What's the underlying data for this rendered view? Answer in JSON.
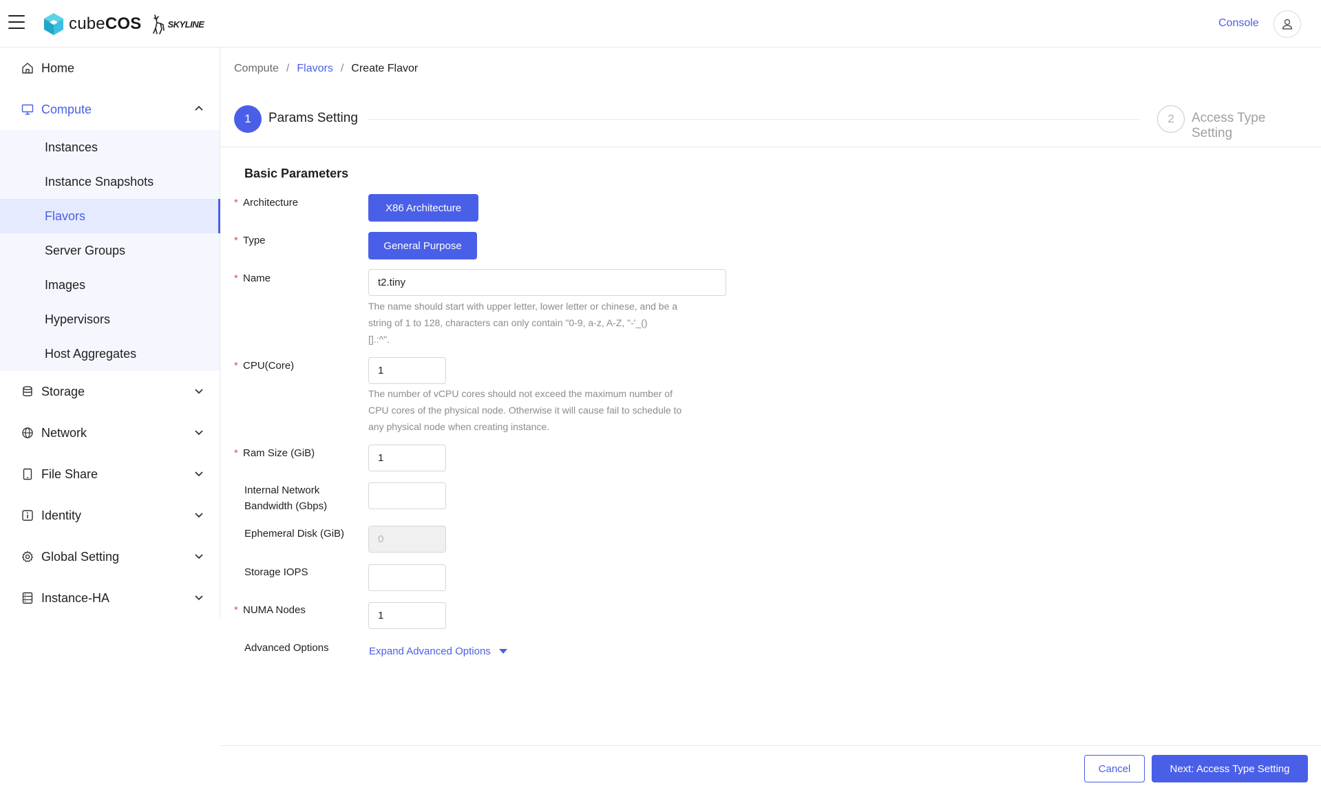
{
  "header": {
    "brand_prefix": "cube",
    "brand_suffix": "COS",
    "skyline_label": "SKYLINE",
    "console_label": "Console",
    "icons": {
      "menu": "hamburger-menu-icon",
      "logo": "cube-logo-icon",
      "skyline": "skyline-deer-icon",
      "user": "user-icon"
    }
  },
  "sidebar": {
    "items": [
      {
        "label": "Home",
        "icon": "home-icon"
      },
      {
        "label": "Compute",
        "icon": "monitor-icon",
        "expanded": true,
        "children": [
          "Instances",
          "Instance Snapshots",
          "Flavors",
          "Server Groups",
          "Images",
          "Hypervisors",
          "Host Aggregates"
        ],
        "selected_child": "Flavors"
      },
      {
        "label": "Storage",
        "icon": "database-icon"
      },
      {
        "label": "Network",
        "icon": "globe-icon"
      },
      {
        "label": "File Share",
        "icon": "tablet-icon"
      },
      {
        "label": "Identity",
        "icon": "info-icon"
      },
      {
        "label": "Global Setting",
        "icon": "gear-icon"
      },
      {
        "label": "Instance-HA",
        "icon": "server-icon"
      }
    ]
  },
  "breadcrumb": {
    "items": [
      "Compute",
      "Flavors",
      "Create Flavor"
    ],
    "separator": "/"
  },
  "steps": [
    {
      "number": "1",
      "label": "Params Setting",
      "status": "active"
    },
    {
      "number": "2",
      "label": "Access Type Setting",
      "status": "pending"
    }
  ],
  "form": {
    "section_title": "Basic Parameters",
    "architecture": {
      "label": "Architecture",
      "value": "X86 Architecture"
    },
    "type": {
      "label": "Type",
      "value": "General Purpose"
    },
    "name": {
      "label": "Name",
      "value": "t2.tiny",
      "help_line1": "The name should start with upper letter, lower letter or chinese, and be a",
      "help_line2": "string of 1 to 128, characters can only contain \"0-9, a-z, A-Z, \"-'_()",
      "help_line3": "[].:^\"."
    },
    "cpu": {
      "label": "CPU(Core)",
      "value": "1",
      "help_line1": "The number of vCPU cores should not exceed the maximum number of",
      "help_line2": "CPU cores of the physical node. Otherwise it will cause fail to schedule to",
      "help_line3": "any physical node when creating instance."
    },
    "ram": {
      "label": "Ram Size (GiB)",
      "value": "1"
    },
    "bandwidth": {
      "label_line1": "Internal Network",
      "label_line2": "Bandwidth (Gbps)",
      "value": ""
    },
    "ephemeral": {
      "label": "Ephemeral Disk (GiB)",
      "placeholder": "0"
    },
    "iops": {
      "label": "Storage IOPS",
      "value": ""
    },
    "numa": {
      "label": "NUMA Nodes",
      "value": "1"
    },
    "advanced": {
      "label": "Advanced Options",
      "link": "Expand Advanced Options"
    }
  },
  "footer": {
    "cancel_label": "Cancel",
    "next_label": "Next: Access Type Setting"
  },
  "colors": {
    "accent": "#4a5fe8",
    "required": "#e34d4d",
    "muted": "#8c8c8c"
  }
}
